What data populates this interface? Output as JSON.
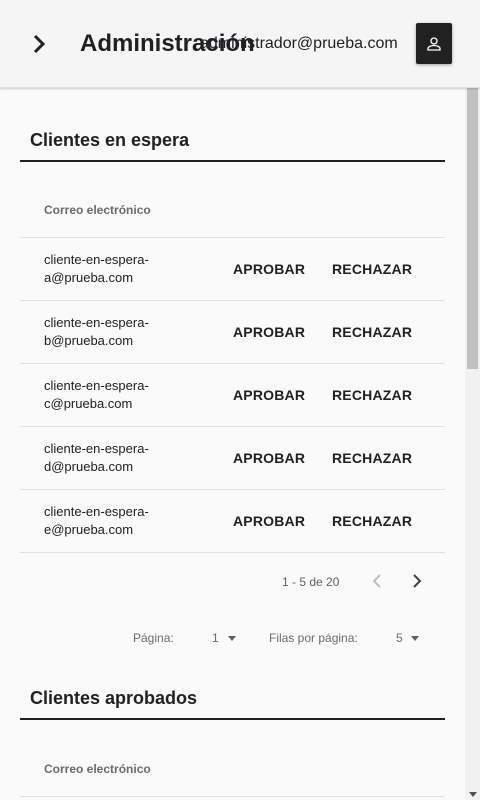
{
  "header": {
    "title": "Administración",
    "user_email": "administrador@prueba.com",
    "menu_icon": "chevron-right-icon",
    "account_icon": "person-icon"
  },
  "pending": {
    "title": "Clientes en espera",
    "column_header": "Correo electrónico",
    "approve_label": "APROBAR",
    "reject_label": "RECHAZAR",
    "rows": [
      {
        "email_line1": "cliente-en-espera-",
        "email_line2": "a@prueba.com"
      },
      {
        "email_line1": "cliente-en-espera-",
        "email_line2": "b@prueba.com"
      },
      {
        "email_line1": "cliente-en-espera-",
        "email_line2": "c@prueba.com"
      },
      {
        "email_line1": "cliente-en-espera-",
        "email_line2": "d@prueba.com"
      },
      {
        "email_line1": "cliente-en-espera-",
        "email_line2": "e@prueba.com"
      }
    ],
    "pagination": {
      "range": "1 - 5 de 20",
      "page_label": "Página:",
      "page_value": "1",
      "rows_label": "Filas por página:",
      "rows_value": "5"
    }
  },
  "approved": {
    "title": "Clientes aprobados",
    "column_header": "Correo electrónico"
  },
  "colors": {
    "accent_dark": "#212121",
    "divider": "#e0e0e0",
    "background": "#fafafa"
  }
}
